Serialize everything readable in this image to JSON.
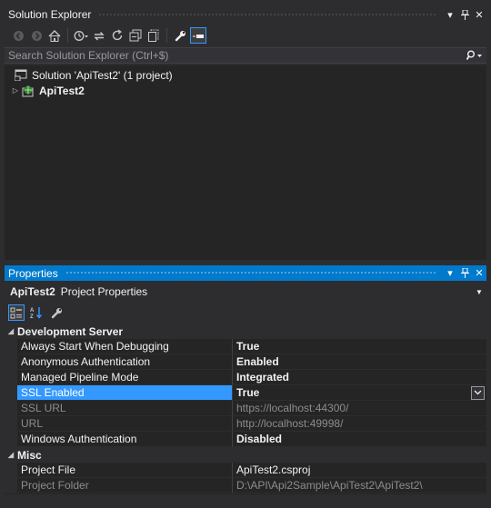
{
  "solution_explorer": {
    "title": "Solution Explorer",
    "search_placeholder": "Search Solution Explorer (Ctrl+$)",
    "tree": [
      {
        "label": "Solution 'ApiTest2' (1 project)",
        "icon": "solution-icon"
      },
      {
        "label": "ApiTest2",
        "icon": "web-project-icon",
        "expanded": false
      }
    ]
  },
  "properties": {
    "title": "Properties",
    "object_name": "ApiTest2",
    "object_type": "Project Properties",
    "categories": [
      {
        "name": "Development Server",
        "rows": [
          {
            "name": "Always Start When Debugging",
            "value": "True",
            "bold": true
          },
          {
            "name": "Anonymous Authentication",
            "value": "Enabled",
            "bold": true
          },
          {
            "name": "Managed Pipeline Mode",
            "value": "Integrated",
            "bold": true
          },
          {
            "name": "SSL Enabled",
            "value": "True",
            "bold": true,
            "selected": true
          },
          {
            "name": "SSL URL",
            "value": "https://localhost:44300/",
            "disabled": true
          },
          {
            "name": "URL",
            "value": "http://localhost:49998/",
            "disabled": true
          },
          {
            "name": "Windows Authentication",
            "value": "Disabled",
            "bold": true
          }
        ]
      },
      {
        "name": "Misc",
        "rows": [
          {
            "name": "Project File",
            "value": "ApiTest2.csproj"
          },
          {
            "name": "Project Folder",
            "value": "D:\\API\\Api2Sample\\ApiTest2\\ApiTest2\\",
            "disabled": true
          }
        ]
      }
    ]
  },
  "colors": {
    "accent": "#007acc",
    "selection": "#3399ff",
    "background": "#252526",
    "chrome": "#2d2d30"
  }
}
